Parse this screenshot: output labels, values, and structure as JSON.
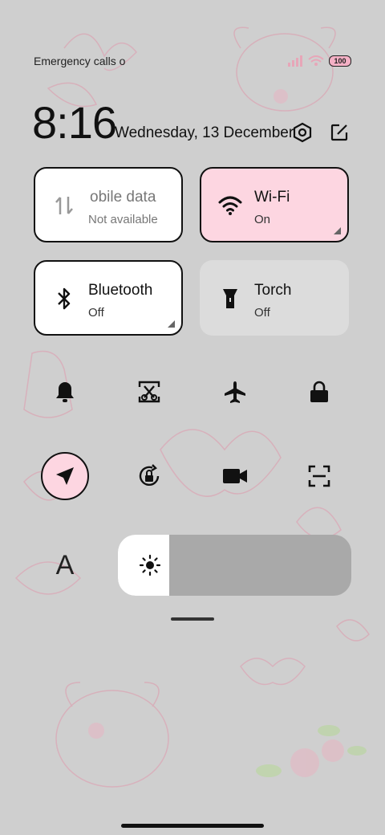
{
  "status_bar": {
    "left_text": "Emergency calls o",
    "battery": "100",
    "icons": [
      "signal-icon",
      "wifi-icon",
      "battery-icon"
    ]
  },
  "header": {
    "time": "8:16",
    "date": "Wednesday, 13 December",
    "icons": [
      "settings-icon",
      "edit-icon"
    ]
  },
  "tiles": [
    {
      "id": "mobile-data",
      "title": "obile data",
      "subtitle": "Not available",
      "icon": "mobile-data-icon",
      "state": "unavailable"
    },
    {
      "id": "wifi",
      "title": "Wi-Fi",
      "subtitle": "On",
      "icon": "wifi-icon",
      "state": "on"
    },
    {
      "id": "bluetooth",
      "title": "Bluetooth",
      "subtitle": "Off",
      "icon": "bluetooth-icon",
      "state": "off"
    },
    {
      "id": "torch",
      "title": "Torch",
      "subtitle": "Off",
      "icon": "torch-icon",
      "state": "off"
    }
  ],
  "quick_toggles_row1": [
    "bell-icon",
    "screenshot-icon",
    "airplane-icon",
    "lock-icon"
  ],
  "quick_toggles_row2": [
    "location-icon",
    "rotation-lock-icon",
    "video-camera-icon",
    "scanner-icon"
  ],
  "font_button": "A",
  "brightness": {
    "level": 0.22,
    "icon": "sun-icon"
  },
  "colors": {
    "accent": "#fdd6e1",
    "background": "#cfcfcf"
  }
}
